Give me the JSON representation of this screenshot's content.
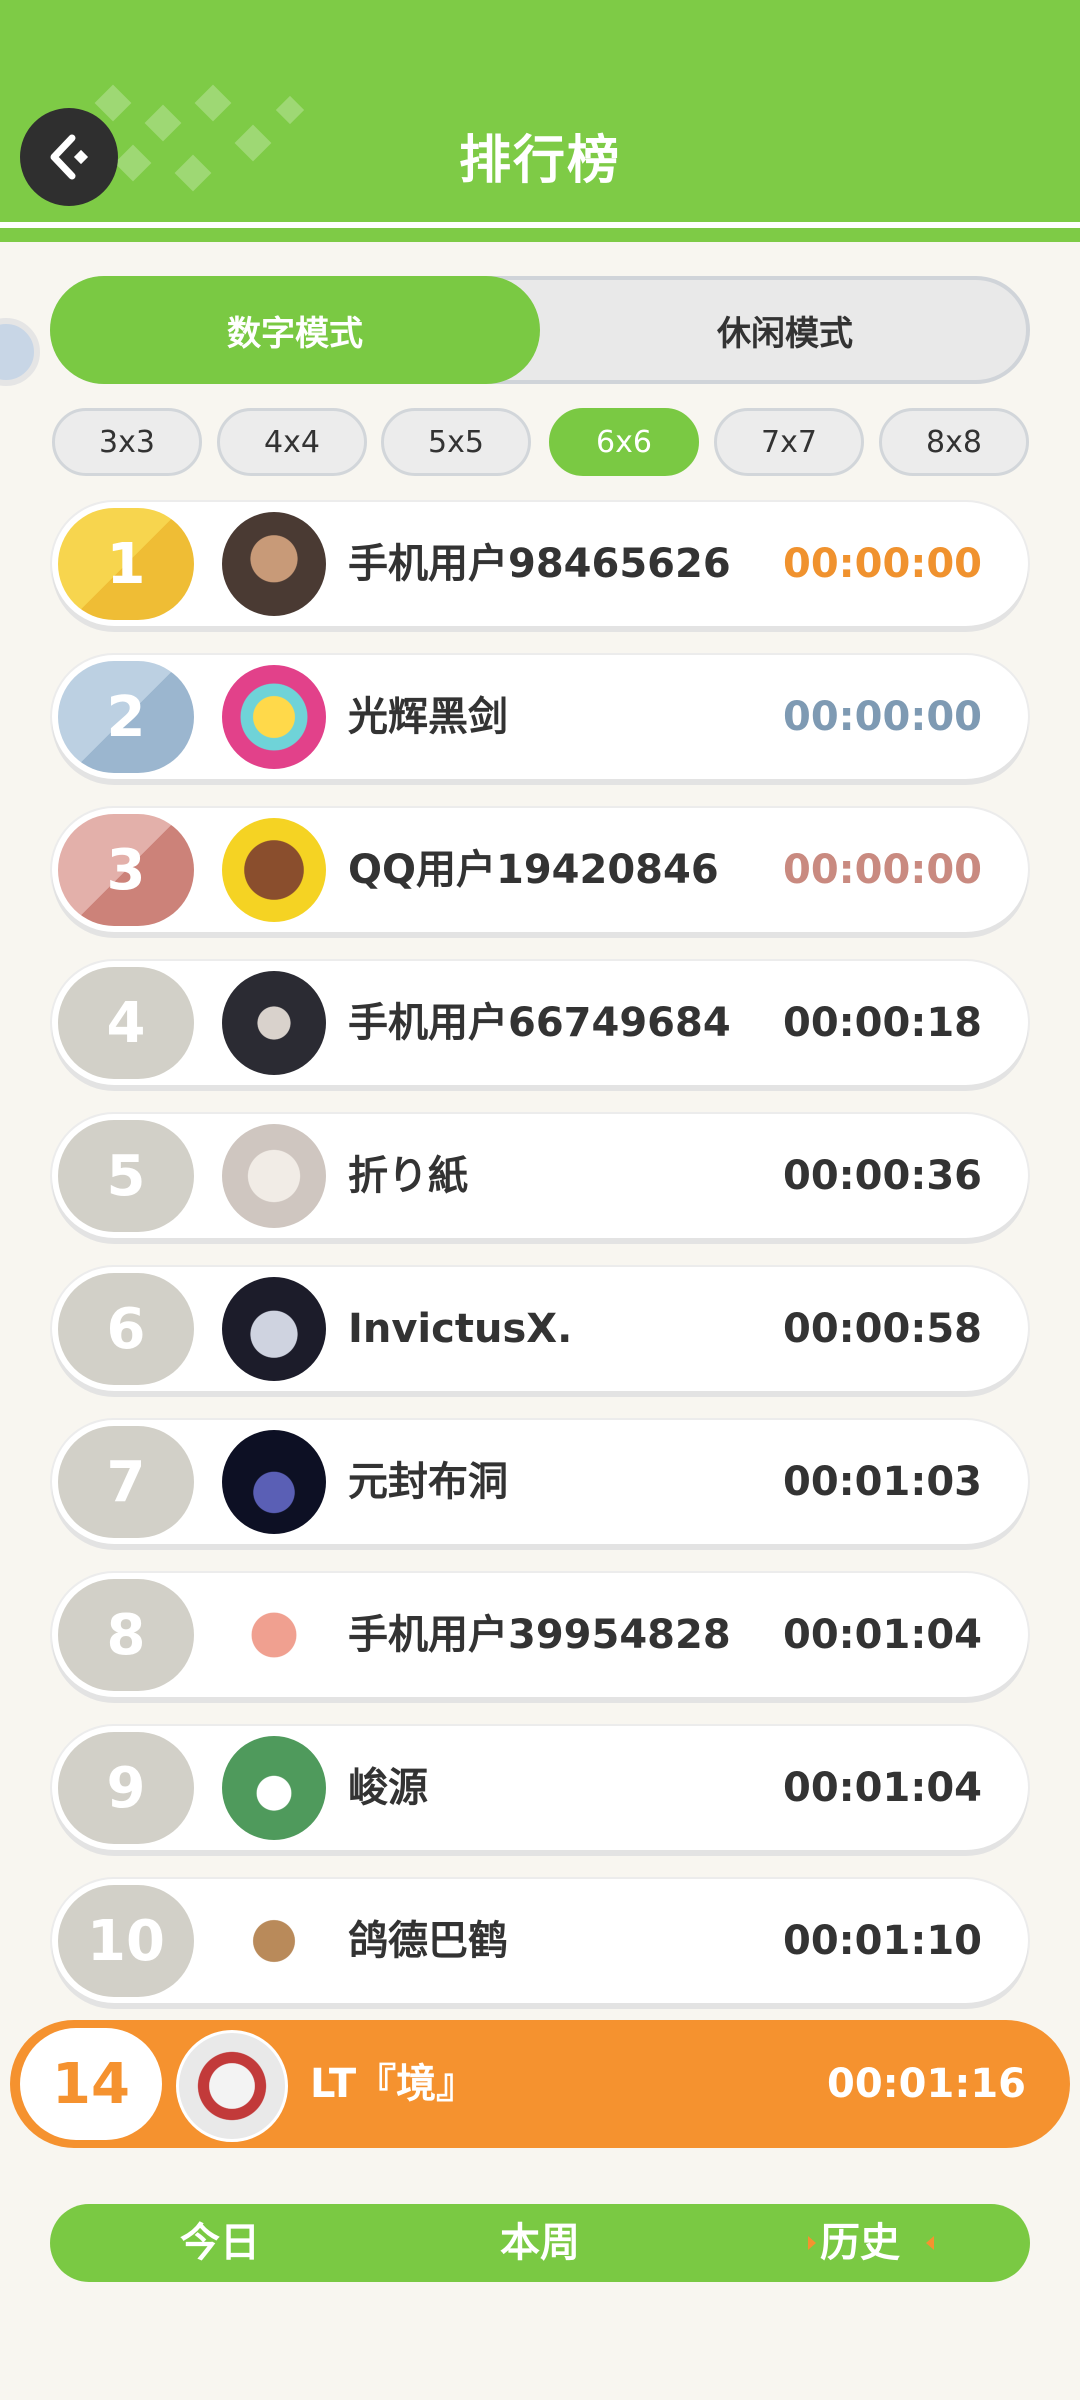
{
  "header": {
    "title": "排行榜"
  },
  "mode_tabs": [
    {
      "label": "数字模式",
      "active": true
    },
    {
      "label": "休闲模式",
      "active": false
    }
  ],
  "size_tabs": [
    {
      "label": "3x3",
      "active": false
    },
    {
      "label": "4x4",
      "active": false
    },
    {
      "label": "5x5",
      "active": false
    },
    {
      "label": "6x6",
      "active": true
    },
    {
      "label": "7x7",
      "active": false
    },
    {
      "label": "8x8",
      "active": false
    }
  ],
  "rankings": [
    {
      "rank": "1",
      "name": "手机用户98465626",
      "time": "00:00:00"
    },
    {
      "rank": "2",
      "name": "光辉黑剑",
      "time": "00:00:00"
    },
    {
      "rank": "3",
      "name": "QQ用户19420846",
      "time": "00:00:00"
    },
    {
      "rank": "4",
      "name": "手机用户66749684",
      "time": "00:00:18"
    },
    {
      "rank": "5",
      "name": "折り紙",
      "time": "00:00:36"
    },
    {
      "rank": "6",
      "name": "InvictusX.",
      "time": "00:00:58"
    },
    {
      "rank": "7",
      "name": "元封布洞",
      "time": "00:01:03"
    },
    {
      "rank": "8",
      "name": "手机用户39954828",
      "time": "00:01:04"
    },
    {
      "rank": "9",
      "name": "峻源",
      "time": "00:01:04"
    },
    {
      "rank": "10",
      "name": "鸽德巴鹤",
      "time": "00:01:10"
    }
  ],
  "my_rank": {
    "rank": "14",
    "name": "LT『境』",
    "time": "00:01:16"
  },
  "period_tabs": [
    {
      "label": "今日",
      "active": false
    },
    {
      "label": "本周",
      "active": false
    },
    {
      "label": "历史",
      "active": true
    }
  ],
  "colors": {
    "accent_green": "#7ac943",
    "gold": "#f3c23a",
    "silver": "#9bb6cf",
    "bronze": "#d08a80",
    "gold_time": "#f0922e",
    "silver_time": "#7e9ab3",
    "bronze_time": "#c98a80",
    "my_row": "#f5922f"
  }
}
